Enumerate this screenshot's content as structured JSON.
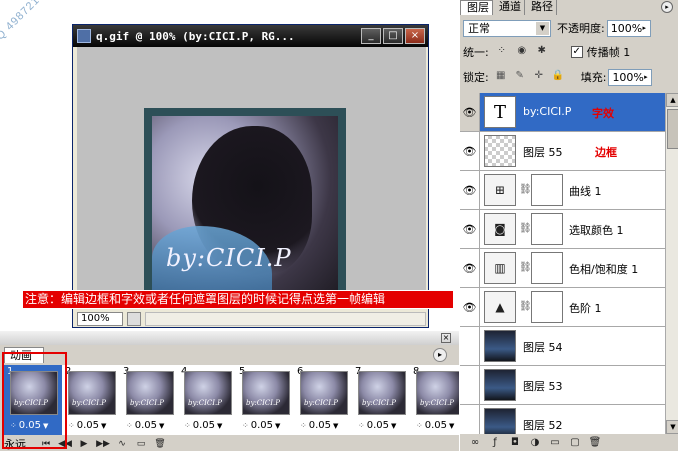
{
  "watermark": "Q 49872103 Cic",
  "doc": {
    "title": "q.gif @ 100% (by:CICI.P, RG...",
    "zoom": "100%",
    "image_text": "by:CICI.P",
    "buttons": {
      "minimize": "_",
      "maximize": "□",
      "close": "×"
    }
  },
  "note": "注意：编辑边框和字效或者任何遮罩图层的时候记得点选第一帧编辑",
  "animation": {
    "tab_label": "动画",
    "loop": "永远",
    "frames": [
      {
        "num": "1",
        "delay": "0.05"
      },
      {
        "num": "2",
        "delay": "0.05"
      },
      {
        "num": "3",
        "delay": "0.05"
      },
      {
        "num": "4",
        "delay": "0.05"
      },
      {
        "num": "5",
        "delay": "0.05"
      },
      {
        "num": "6",
        "delay": "0.05"
      },
      {
        "num": "7",
        "delay": "0.05"
      },
      {
        "num": "8",
        "delay": "0.05"
      }
    ],
    "thumb_text": "by:CICI.P",
    "controls": [
      "⏮",
      "◀◀",
      "▶",
      "▶▶",
      "∿",
      "▭",
      "🗑"
    ]
  },
  "layers_panel": {
    "tabs": [
      "图层",
      "通道",
      "路径"
    ],
    "blend_mode": "正常",
    "opacity_label": "不透明度:",
    "opacity": "100%",
    "unify_label": "统一:",
    "propagate_label": "传播帧 1",
    "lock_label": "锁定:",
    "fill_label": "填充:",
    "fill": "100%",
    "layers": [
      {
        "name": "by:CICI.P",
        "thumb": "T",
        "note": "字效",
        "active": true
      },
      {
        "name": "图层 55",
        "thumb": "",
        "note": "边框"
      },
      {
        "name": "曲线 1",
        "thumb": "⊞"
      },
      {
        "name": "选取颜色 1",
        "thumb": "◙"
      },
      {
        "name": "色相/饱和度 1",
        "thumb": "▥"
      },
      {
        "name": "色阶 1",
        "thumb": "▲"
      },
      {
        "name": "图层 54",
        "thumb": ""
      },
      {
        "name": "图层 53",
        "thumb": ""
      },
      {
        "name": "图层 52",
        "thumb": ""
      }
    ],
    "bottom_icons": [
      "∞",
      "ƒ",
      "◘",
      "◑",
      "▭",
      "▢",
      "🗑"
    ]
  }
}
